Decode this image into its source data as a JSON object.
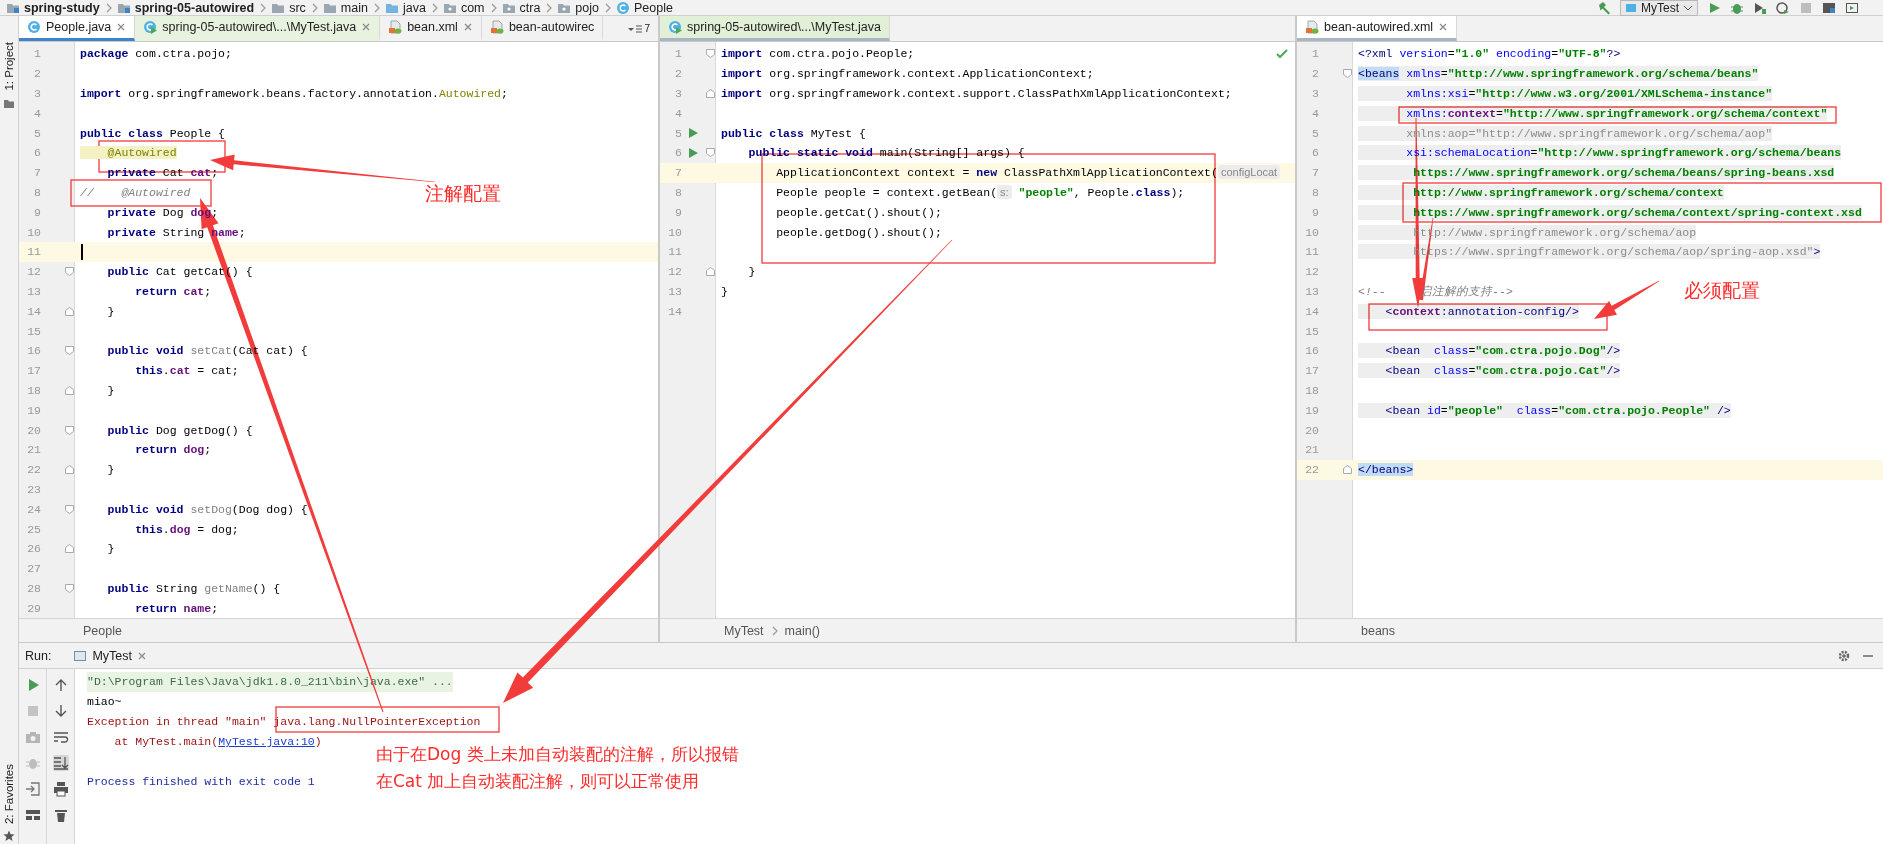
{
  "breadcrumbs": [
    {
      "text": "spring-study",
      "kind": "module"
    },
    {
      "text": "spring-05-autowired",
      "kind": "module"
    },
    {
      "text": "src",
      "kind": "folder"
    },
    {
      "text": "main",
      "kind": "folder"
    },
    {
      "text": "java",
      "kind": "source"
    },
    {
      "text": "com",
      "kind": "package"
    },
    {
      "text": "ctra",
      "kind": "package"
    },
    {
      "text": "pojo",
      "kind": "package"
    },
    {
      "text": "People",
      "kind": "class"
    }
  ],
  "toolbar": {
    "run_config": "MyTest"
  },
  "tool_strip": {
    "top": "1: Project",
    "bottom": "2: Favorites"
  },
  "panes": [
    {
      "focused": true,
      "overflow": "7",
      "tabs": [
        {
          "label": "People.java",
          "kind": "class",
          "selected": true,
          "closable": true
        },
        {
          "label": "spring-05-autowired\\...\\MyTest.java",
          "kind": "test",
          "selected": false,
          "closable": true
        },
        {
          "label": "bean.xml",
          "kind": "xml",
          "selected": false,
          "closable": true
        },
        {
          "label": "bean-autowirec",
          "kind": "xml",
          "selected": false,
          "closable": false
        }
      ],
      "lines": [
        {
          "number": "1",
          "tokens": [
            {
              "kind": "keyword",
              "text": "package"
            },
            {
              "text": " com.ctra.pojo;"
            }
          ]
        },
        {
          "number": "2"
        },
        {
          "number": "3",
          "tokens": [
            {
              "kind": "keyword",
              "text": "import"
            },
            {
              "text": " org.springframework.beans.factory.annotation."
            },
            {
              "kind": "annotation",
              "text": "Autowired"
            },
            {
              "text": ";"
            }
          ]
        },
        {
          "number": "4"
        },
        {
          "number": "5",
          "tokens": [
            {
              "kind": "keyword",
              "text": "public class"
            },
            {
              "text": " People {"
            }
          ]
        },
        {
          "number": "6",
          "tokens": [
            {
              "kind": "annotation-hl",
              "text": "    @Autowired"
            }
          ]
        },
        {
          "number": "7",
          "tokens": [
            {
              "kind": "keyword",
              "text": "    private"
            },
            {
              "text": " Cat "
            },
            {
              "kind": "field",
              "text": "cat"
            },
            {
              "text": ";"
            }
          ]
        },
        {
          "number": "8",
          "tokens": [
            {
              "kind": "comment",
              "text": "//    @Autowired"
            }
          ]
        },
        {
          "number": "9",
          "tokens": [
            {
              "kind": "keyword",
              "text": "    private"
            },
            {
              "text": " Dog "
            },
            {
              "kind": "field",
              "text": "dog"
            },
            {
              "text": ";"
            }
          ]
        },
        {
          "number": "10",
          "tokens": [
            {
              "kind": "keyword",
              "text": "    private"
            },
            {
              "text": " String "
            },
            {
              "kind": "field",
              "text": "name"
            },
            {
              "text": ";"
            }
          ]
        },
        {
          "number": "11",
          "current": true
        },
        {
          "number": "12",
          "fold_start": true,
          "tokens": [
            {
              "kind": "keyword",
              "text": "    public"
            },
            {
              "text": " Cat getCat() {"
            }
          ]
        },
        {
          "number": "13",
          "tokens": [
            {
              "kind": "keyword",
              "text": "        return "
            },
            {
              "kind": "field",
              "text": "cat"
            },
            {
              "text": ";"
            }
          ]
        },
        {
          "number": "14",
          "fold_end": true,
          "tokens": [
            {
              "text": "    }"
            }
          ]
        },
        {
          "number": "15"
        },
        {
          "number": "16",
          "fold_start": true,
          "tokens": [
            {
              "kind": "keyword",
              "text": "    public void "
            },
            {
              "kind": "unused",
              "text": "setCat"
            },
            {
              "text": "(Cat cat) {"
            }
          ]
        },
        {
          "number": "17",
          "tokens": [
            {
              "kind": "keyword",
              "text": "        this"
            },
            {
              "text": "."
            },
            {
              "kind": "field",
              "text": "cat"
            },
            {
              "text": " = cat;"
            }
          ]
        },
        {
          "number": "18",
          "fold_end": true,
          "tokens": [
            {
              "text": "    }"
            }
          ]
        },
        {
          "number": "19"
        },
        {
          "number": "20",
          "fold_start": true,
          "tokens": [
            {
              "kind": "keyword",
              "text": "    public"
            },
            {
              "text": " Dog getDog() {"
            }
          ]
        },
        {
          "number": "21",
          "tokens": [
            {
              "kind": "keyword",
              "text": "        return "
            },
            {
              "kind": "field",
              "text": "dog"
            },
            {
              "text": ";"
            }
          ]
        },
        {
          "number": "22",
          "fold_end": true,
          "tokens": [
            {
              "text": "    }"
            }
          ]
        },
        {
          "number": "23"
        },
        {
          "number": "24",
          "fold_start": true,
          "tokens": [
            {
              "kind": "keyword",
              "text": "    public void "
            },
            {
              "kind": "unused",
              "text": "setDog"
            },
            {
              "text": "(Dog dog) {"
            }
          ]
        },
        {
          "number": "25",
          "tokens": [
            {
              "kind": "keyword",
              "text": "        this"
            },
            {
              "text": "."
            },
            {
              "kind": "field",
              "text": "dog"
            },
            {
              "text": " = dog;"
            }
          ]
        },
        {
          "number": "26",
          "fold_end": true,
          "tokens": [
            {
              "text": "    }"
            }
          ]
        },
        {
          "number": "27"
        },
        {
          "number": "28",
          "fold_start": true,
          "tokens": [
            {
              "kind": "keyword",
              "text": "    public"
            },
            {
              "text": " String "
            },
            {
              "kind": "unused",
              "text": "getName"
            },
            {
              "text": "() {"
            }
          ]
        },
        {
          "number": "29",
          "tokens": [
            {
              "kind": "keyword",
              "text": "        return "
            },
            {
              "kind": "field",
              "text": "name"
            },
            {
              "text": ";"
            }
          ]
        }
      ],
      "footer": [
        "People"
      ]
    },
    {
      "focused": false,
      "inspection_passed": true,
      "tabs": [
        {
          "label": "spring-05-autowired\\...\\MyTest.java",
          "kind": "test",
          "selected": true,
          "closable": false
        }
      ],
      "lines": [
        {
          "number": "1",
          "fold_start": true,
          "tokens": [
            {
              "kind": "keyword",
              "text": "import"
            },
            {
              "text": " com.ctra.pojo.People;"
            }
          ]
        },
        {
          "number": "2",
          "tokens": [
            {
              "kind": "keyword",
              "text": "import"
            },
            {
              "text": " org.springframework.context.ApplicationContext;"
            }
          ]
        },
        {
          "number": "3",
          "fold_end": true,
          "tokens": [
            {
              "kind": "keyword",
              "text": "import"
            },
            {
              "text": " org.springframework.context.support.ClassPathXmlApplicationContext;"
            }
          ]
        },
        {
          "number": "4"
        },
        {
          "number": "5",
          "runnable": true,
          "tokens": [
            {
              "kind": "keyword",
              "text": "public class"
            },
            {
              "text": " MyTest {"
            }
          ]
        },
        {
          "number": "6",
          "runnable": true,
          "fold_start": true,
          "tokens": [
            {
              "kind": "keyword",
              "text": "    public static void"
            },
            {
              "text": " main(String[] args) {"
            }
          ]
        },
        {
          "number": "7",
          "current": true,
          "tokens": [
            {
              "text": "        ApplicationContext context = "
            },
            {
              "kind": "keyword",
              "text": "new"
            },
            {
              "text": " ClassPathXmlApplicationContext("
            },
            {
              "kind": "hint",
              "text": "configLocat"
            }
          ]
        },
        {
          "number": "8",
          "tokens": [
            {
              "text": "        People people = context.getBean("
            },
            {
              "kind": "hint",
              "text": "s:"
            },
            {
              "kind": "string",
              "text": " \"people\""
            },
            {
              "text": ", People."
            },
            {
              "kind": "keyword",
              "text": "class"
            },
            {
              "text": ");"
            }
          ]
        },
        {
          "number": "9",
          "tokens": [
            {
              "text": "        people.getCat().shout();"
            }
          ]
        },
        {
          "number": "10",
          "tokens": [
            {
              "text": "        people.getDog().shout();"
            }
          ]
        },
        {
          "number": "11"
        },
        {
          "number": "12",
          "fold_end": true,
          "tokens": [
            {
              "text": "    }"
            }
          ]
        },
        {
          "number": "13",
          "tokens": [
            {
              "text": "}"
            }
          ]
        },
        {
          "number": "14"
        }
      ],
      "footer": [
        "MyTest",
        "main()"
      ]
    },
    {
      "focused": false,
      "tabs": [
        {
          "label": "bean-autowired.xml",
          "kind": "xml",
          "selected": true,
          "closable": true
        }
      ],
      "lines": [
        {
          "number": "1",
          "tokens": [
            {
              "kind": "tag",
              "text": "<?xml "
            },
            {
              "kind": "attr",
              "text": "version"
            },
            {
              "text": "="
            },
            {
              "kind": "value",
              "text": "\"1.0\" "
            },
            {
              "kind": "attr",
              "text": "encoding"
            },
            {
              "text": "="
            },
            {
              "kind": "value",
              "text": "\"UTF-8\""
            },
            {
              "kind": "tag",
              "text": "?>"
            }
          ]
        },
        {
          "number": "2",
          "fold_start": true,
          "shaded": true,
          "tokens": [
            {
              "kind": "tag-match",
              "text": "<beans"
            },
            {
              "kind": "attr",
              "text": " xmlns"
            },
            {
              "text": "="
            },
            {
              "kind": "value",
              "text": "\"http://www.springframework.org/schema/beans\""
            }
          ]
        },
        {
          "number": "3",
          "shaded": true,
          "tokens": [
            {
              "kind": "attr",
              "text": "       xmlns:xsi"
            },
            {
              "text": "="
            },
            {
              "kind": "value",
              "text": "\"http://www.w3.org/2001/XMLSchema-instance\""
            }
          ]
        },
        {
          "number": "4",
          "shaded": true,
          "tokens": [
            {
              "kind": "attr",
              "text": "       xmlns:"
            },
            {
              "kind": "ns",
              "text": "context"
            },
            {
              "text": "="
            },
            {
              "kind": "value",
              "text": "\"http://www.springframework.org/schema/context\""
            }
          ]
        },
        {
          "number": "5",
          "shaded": true,
          "tokens": [
            {
              "kind": "muted",
              "text": "       xmlns:aop=\"http://www.springframework.org/schema/aop\""
            }
          ]
        },
        {
          "number": "6",
          "shaded": true,
          "tokens": [
            {
              "kind": "attr",
              "text": "       xsi:schemaLocation"
            },
            {
              "text": "="
            },
            {
              "kind": "value",
              "text": "\"http://www.springframework.org/schema/beans"
            }
          ]
        },
        {
          "number": "7",
          "shaded": true,
          "tokens": [
            {
              "kind": "value",
              "text": "        https://www.springframework.org/schema/beans/spring-beans.xsd"
            }
          ]
        },
        {
          "number": "8",
          "shaded": true,
          "tokens": [
            {
              "kind": "value",
              "text": "        http://www.springframework.org/schema/context"
            }
          ]
        },
        {
          "number": "9",
          "shaded": true,
          "tokens": [
            {
              "kind": "value",
              "text": "        https://www.springframework.org/schema/context/spring-context.xsd"
            }
          ]
        },
        {
          "number": "10",
          "shaded": true,
          "tokens": [
            {
              "kind": "muted",
              "text": "        http://www.springframework.org/schema/aop"
            }
          ]
        },
        {
          "number": "11",
          "shaded": true,
          "tokens": [
            {
              "kind": "muted",
              "text": "        https://www.springframework.org/schema/aop/spring-aop.xsd\""
            },
            {
              "kind": "tag",
              "text": ">"
            }
          ]
        },
        {
          "number": "12"
        },
        {
          "number": "13",
          "tokens": [
            {
              "kind": "comment",
              "text": "<!--     启注解的支持-->"
            }
          ]
        },
        {
          "number": "14",
          "shaded": true,
          "tokens": [
            {
              "kind": "tag",
              "text": "    <"
            },
            {
              "kind": "ns",
              "text": "context"
            },
            {
              "kind": "tag",
              "text": ":annotation-config/>"
            }
          ]
        },
        {
          "number": "15"
        },
        {
          "number": "16",
          "shaded": true,
          "tokens": [
            {
              "kind": "tag",
              "text": "    <bean  "
            },
            {
              "kind": "attr",
              "text": "class"
            },
            {
              "text": "="
            },
            {
              "kind": "value",
              "text": "\"com.ctra.pojo.Dog\""
            },
            {
              "kind": "tag",
              "text": "/>"
            }
          ]
        },
        {
          "number": "17",
          "shaded": true,
          "tokens": [
            {
              "kind": "tag",
              "text": "    <bean  "
            },
            {
              "kind": "attr",
              "text": "class"
            },
            {
              "text": "="
            },
            {
              "kind": "value",
              "text": "\"com.ctra.pojo.Cat\""
            },
            {
              "kind": "tag",
              "text": "/>"
            }
          ]
        },
        {
          "number": "18"
        },
        {
          "number": "19",
          "shaded": true,
          "tokens": [
            {
              "kind": "tag",
              "text": "    <bean "
            },
            {
              "kind": "attr",
              "text": "id"
            },
            {
              "text": "="
            },
            {
              "kind": "value",
              "text": "\"people\"  "
            },
            {
              "kind": "attr",
              "text": "class"
            },
            {
              "text": "="
            },
            {
              "kind": "value",
              "text": "\"com.ctra.pojo.People\""
            },
            {
              "kind": "tag",
              "text": " />"
            }
          ]
        },
        {
          "number": "20"
        },
        {
          "number": "21"
        },
        {
          "number": "22",
          "current": true,
          "fold_end": true,
          "tokens": [
            {
              "kind": "tag-match",
              "text": "</beans>"
            }
          ]
        }
      ],
      "footer": [
        "beans"
      ]
    }
  ],
  "run_panel": {
    "label": "Run:",
    "tab": "MyTest",
    "console": [
      {
        "kind": "command",
        "tokens": [
          {
            "text": "\"D:\\Program Files\\Java\\jdk1.8.0_211\\bin\\java.exe\" ..."
          }
        ]
      },
      {
        "kind": "output",
        "tokens": [
          {
            "text": "miao~"
          }
        ]
      },
      {
        "kind": "error",
        "tokens": [
          {
            "text": "Exception in thread \"main\" java.lang.NullPointerException"
          }
        ]
      },
      {
        "kind": "error",
        "tokens": [
          {
            "text": "    at MyTest.main("
          },
          {
            "kind": "link",
            "text": "MyTest.java:10"
          },
          {
            "text": ")"
          }
        ]
      },
      {
        "kind": "blank"
      },
      {
        "kind": "exit",
        "tokens": [
          {
            "text": "Process finished with exit code 1"
          }
        ]
      }
    ]
  },
  "annotations": [
    {
      "text": "注解配置"
    },
    {
      "text": "必须配置"
    },
    {
      "lines": [
        "由于在Dog 类上未加自动装配的注解，所以报错",
        "在Cat 加上自动装配注解，则可以正常使用"
      ]
    }
  ]
}
